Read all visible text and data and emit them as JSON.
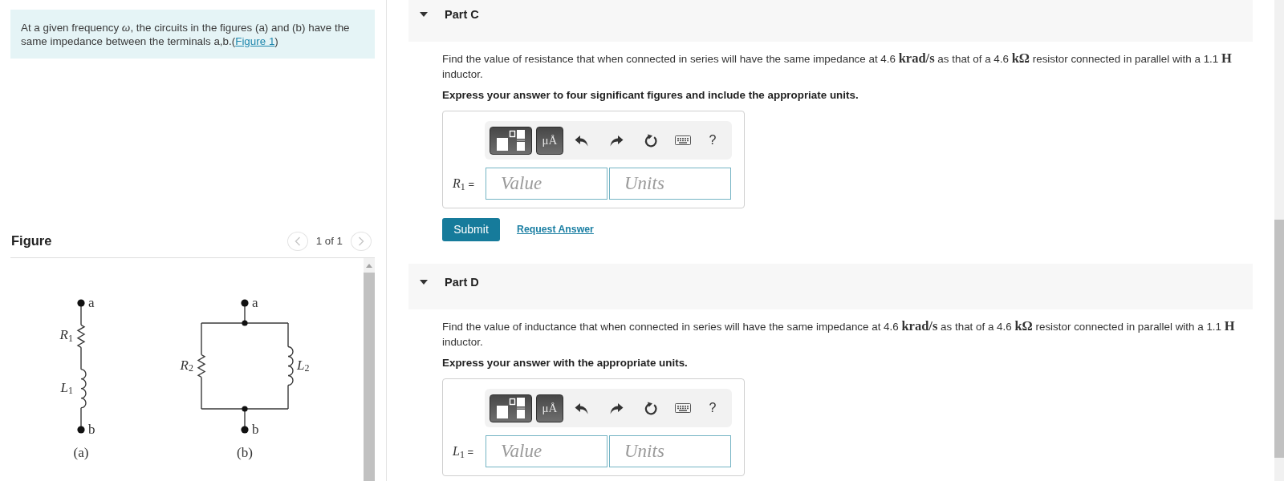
{
  "intro": {
    "text": "At a given frequency *ω*, the circuits in the figures (a) and (b) have the same impedance between the terminals a,b.(",
    "link": "Figure 1",
    "after": ")"
  },
  "figure": {
    "title": "Figure",
    "pager": {
      "prev_disabled": true,
      "label": "1 of 1",
      "next_disabled": true
    },
    "circuits": [
      {
        "kind": "series",
        "terminals": [
          "a",
          "b"
        ],
        "components": [
          {
            "kind": "resistor",
            "label": "*R*$_{1}$"
          },
          {
            "kind": "inductor",
            "label": "*L*$_{1}$"
          }
        ],
        "caption": "(a)"
      },
      {
        "kind": "parallel",
        "terminals": [
          "a",
          "b"
        ],
        "components": [
          {
            "kind": "resistor",
            "label": "*R*$_{2}$"
          },
          {
            "kind": "inductor",
            "label": "*L*$_{2}$"
          }
        ],
        "caption": "(b)"
      }
    ]
  },
  "parts": [
    {
      "title": "Part C",
      "expanded": true,
      "prompt": "Find the value of resistance that when connected in series will have the same impedance at 4.6 **krad/s** as that of a 4.6 **kΩ** resistor connected in parallel with a 1.1 **H** inductor.",
      "instruction": "Express your answer to four significant figures and include the appropriate units.",
      "toolbar": {
        "units_button": "μÅ",
        "help": "?"
      },
      "answer": {
        "label": "*R*$_{1}$ =",
        "value": {
          "placeholder": "Value"
        },
        "units": {
          "placeholder": "Units"
        }
      },
      "submit": "Submit",
      "request": "Request Answer"
    },
    {
      "title": "Part D",
      "expanded": true,
      "prompt": "Find the value of inductance that when connected in series will have the same impedance at 4.6 **krad/s** as that of a 4.6 **kΩ** resistor connected in parallel with a 1.1 **H** inductor.",
      "instruction": "Express your answer with the appropriate units.",
      "toolbar": {
        "units_button": "μÅ",
        "help": "?"
      },
      "answer": {
        "label": "*L*$_{1}$ =",
        "value": {
          "placeholder": "Value"
        },
        "units": {
          "placeholder": "Units"
        }
      }
    }
  ]
}
